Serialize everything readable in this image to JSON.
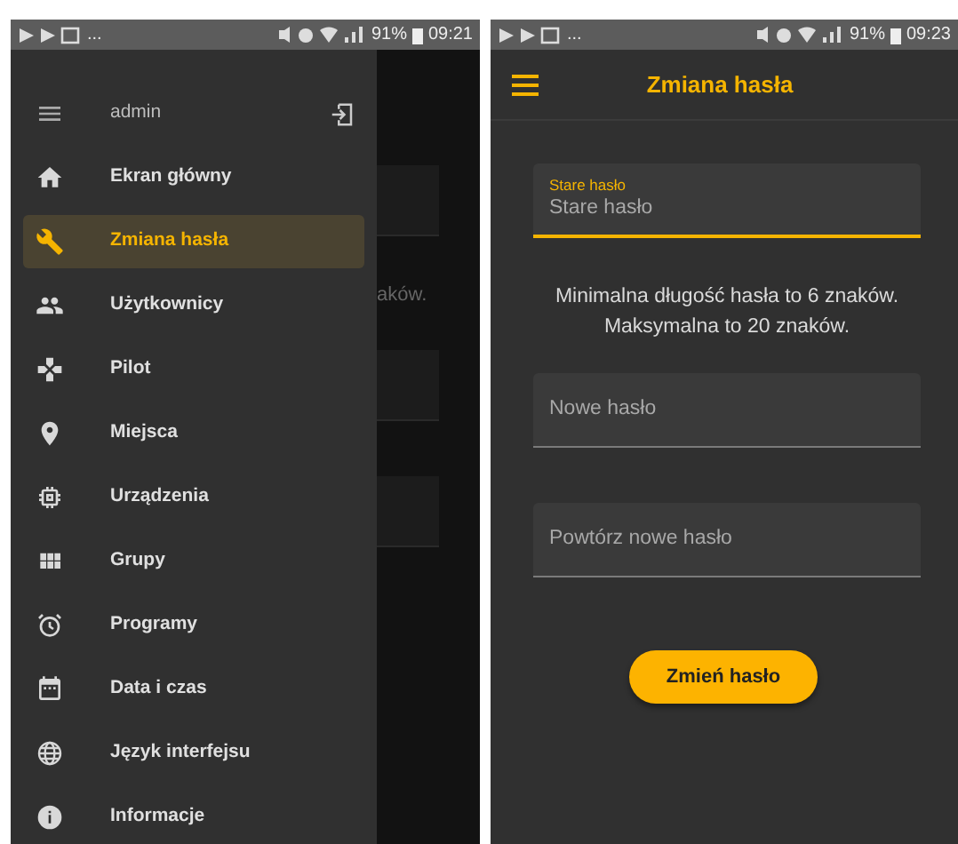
{
  "left_screen": {
    "status_bar": {
      "notifications_more": "...",
      "battery": "91%",
      "time": "09:21"
    },
    "drawer": {
      "user": "admin",
      "items": [
        {
          "label": "Ekran główny",
          "selected": false
        },
        {
          "label": "Zmiana hasła",
          "selected": true
        },
        {
          "label": "Użytkownicy",
          "selected": false
        },
        {
          "label": "Pilot",
          "selected": false
        },
        {
          "label": "Miejsca",
          "selected": false
        },
        {
          "label": "Urządzenia",
          "selected": false
        },
        {
          "label": "Grupy",
          "selected": false
        },
        {
          "label": "Programy",
          "selected": false
        },
        {
          "label": "Data i czas",
          "selected": false
        },
        {
          "label": "Język interfejsu",
          "selected": false
        },
        {
          "label": "Informacje",
          "selected": false
        }
      ]
    },
    "background": {
      "text": "aków."
    }
  },
  "right_screen": {
    "status_bar": {
      "notifications_more": "...",
      "battery": "91%",
      "time": "09:23"
    },
    "title": "Zmiana hasła",
    "fields": [
      {
        "label": "Stare hasło",
        "placeholder": "Stare hasło",
        "focused": true
      }
    ],
    "hint": [
      "Minimalna długość hasła to 6 znaków.",
      "Maksymalna to 20 znaków."
    ],
    "fields_after": [
      {
        "placeholder": "Nowe hasło",
        "focused": false
      },
      {
        "placeholder": "Powtórz nowe hasło",
        "focused": false
      }
    ],
    "button": "Zmień hasło"
  }
}
